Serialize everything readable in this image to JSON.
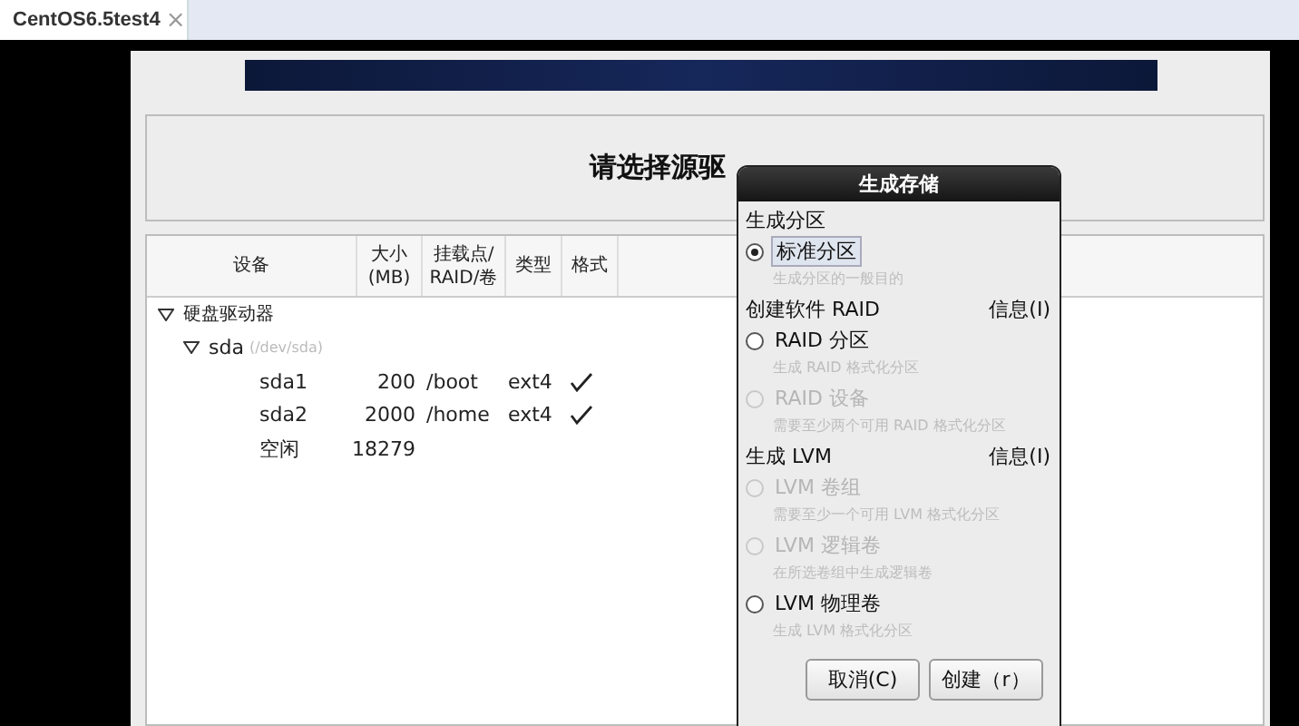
{
  "tab": {
    "title": "CentOS6.5test4",
    "close": "×"
  },
  "heading": "请选择源驱",
  "table": {
    "columns": [
      {
        "lines": [
          "设备"
        ]
      },
      {
        "lines": [
          "大小",
          "(MB)"
        ]
      },
      {
        "lines": [
          "挂载点/",
          "RAID/卷"
        ]
      },
      {
        "lines": [
          "类型"
        ]
      },
      {
        "lines": [
          "格式"
        ]
      }
    ],
    "tree": [
      {
        "label": "硬盘驱动器",
        "expanded": true,
        "children": [
          {
            "label": "sda",
            "note": "(/dev/sda)",
            "expanded": true,
            "children": [
              {
                "label": "sda1",
                "size": "200",
                "mount": "/boot",
                "type": "ext4",
                "format": true
              },
              {
                "label": "sda2",
                "size": "2000",
                "mount": "/home",
                "type": "ext4",
                "format": true
              },
              {
                "label": "空闲",
                "size": "18279"
              }
            ]
          }
        ]
      }
    ]
  },
  "dialog": {
    "title": "生成存储",
    "sections": [
      {
        "title": "生成分区",
        "options": [
          {
            "label": "标准分区",
            "hint": "生成分区的一般目的",
            "selected": true,
            "disabled": false
          }
        ]
      },
      {
        "title": "创建软件 RAID",
        "info": "信息(I)",
        "options": [
          {
            "label": "RAID 分区",
            "hint": "生成 RAID 格式化分区",
            "selected": false,
            "disabled": false
          },
          {
            "label": "RAID 设备",
            "hint": "需要至少两个可用 RAID 格式化分区",
            "selected": false,
            "disabled": true
          }
        ]
      },
      {
        "title": "生成 LVM",
        "info": "信息(I)",
        "options": [
          {
            "label": "LVM 卷组",
            "hint": "需要至少一个可用 LVM 格式化分区",
            "selected": false,
            "disabled": true
          },
          {
            "label": "LVM 逻辑卷",
            "hint": "在所选卷组中生成逻辑卷",
            "selected": false,
            "disabled": true
          },
          {
            "label": "LVM 物理卷",
            "hint": "生成 LVM 格式化分区",
            "selected": false,
            "disabled": false
          }
        ]
      }
    ],
    "buttons": [
      "取消(C)",
      "创建（r）"
    ]
  }
}
